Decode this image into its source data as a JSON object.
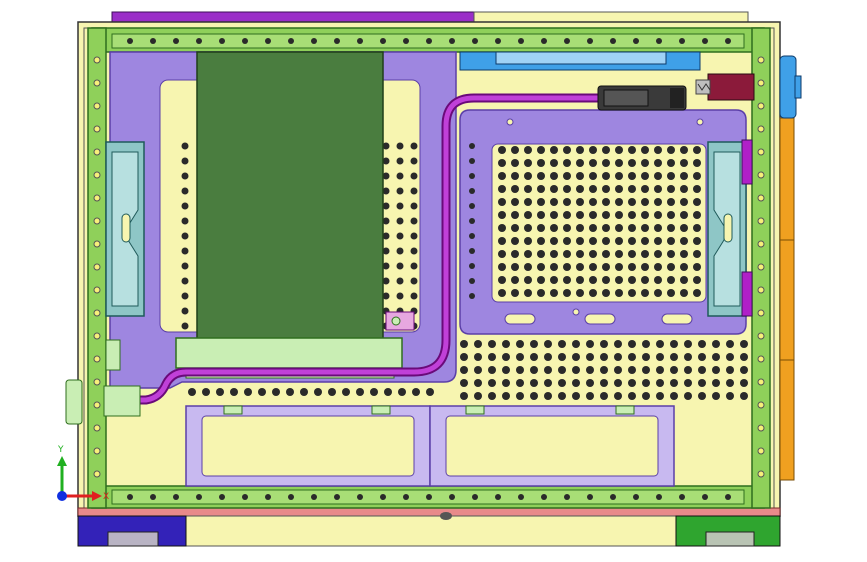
{
  "viewport": {
    "background": "#ffffff",
    "description_free": true
  },
  "triad": {
    "x_label": "X",
    "y_label": "Y",
    "x_color": "#e02020",
    "y_color": "#20b020",
    "z_color": "#1030e0"
  },
  "colors": {
    "chassis": "#f7f5b0",
    "frame_green": "#8fd05a",
    "frame_dark": "#2f6e1e",
    "plate_purple": "#9e86e0",
    "plate_edge": "#5b3fa8",
    "pcb_green": "#4a7d3f",
    "tube_magenta": "#b020c8",
    "bracket_teal": "#8ec6c6",
    "blue_part": "#3fa0e8",
    "orange_part": "#f0a020",
    "bottom_purple": "#3322b8",
    "bottom_green": "#2fa52f",
    "hole": "#2a2a2a",
    "light_green": "#c9eeb4",
    "pink_strip": "#e88a8a"
  }
}
